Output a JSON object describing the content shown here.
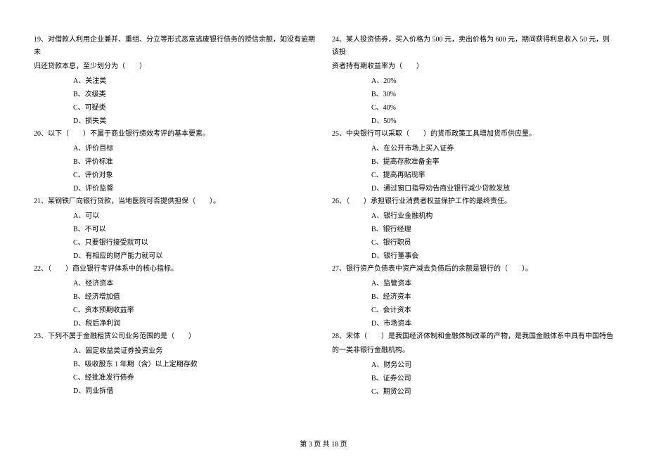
{
  "left": {
    "q19": {
      "line1": "19、对借款人利用企业兼并、重组、分立等形式恶意逃废银行债务的授信余额，如没有逾期未",
      "line2": "归还贷款本息，至少划分为（　　）",
      "opts": [
        "A、关注类",
        "B、次级类",
        "C、可疑类",
        "D、损失类"
      ]
    },
    "q20": {
      "line1": "20、以下（　　）不属于商业银行绩效考评的基本要素。",
      "opts": [
        "A、评价目标",
        "B、评价标准",
        "C、评价对象",
        "D、评价监督"
      ]
    },
    "q21": {
      "line1": "21、某钢铁厂向银行贷款，当地医院可否提供担保（　　）。",
      "opts": [
        "A、可以",
        "B、不可以",
        "C、只要银行接受就可以",
        "D、有相应的财产能力就可以"
      ]
    },
    "q22": {
      "line1": "22、（　　）商业银行考评体系中的核心指标。",
      "opts": [
        "A、经济资本",
        "B、经济增加值",
        "C、资本预期收益率",
        "D、税后净利润"
      ]
    },
    "q23": {
      "line1": "23、下列不属于金融租赁公司业务范围的是（　　）",
      "opts": [
        "A、固定收益类证券投资业务",
        "B、吸收股东 1 年期（含）以上定期存款",
        "C、经批准发行债券",
        "D、同业拆借"
      ]
    }
  },
  "right": {
    "q24": {
      "line1": "24、某人投资债券，买入价格为 500 元，卖出价格为 600 元，期间获得利息收入 50 元，则该投",
      "line2": "资者持有期收益率为（　　）",
      "opts": [
        "A、20%",
        "B、30%",
        "C、40%",
        "D、50%"
      ]
    },
    "q25": {
      "line1": "25、中央银行可以采取（　　）的货币政策工具增加货币供应量。",
      "opts": [
        "A、在公开市场上买入证券",
        "B、提高存款准备金率",
        "C、提高再贴现率",
        "D、通过窗口指导劝告商业银行减少贷款发放"
      ]
    },
    "q26": {
      "line1": "26、（　　）承担银行业消费者权益保护工作的最终责任。",
      "opts": [
        "A、银行业金融机构",
        "B、银行经理",
        "C、银行职员",
        "D、银行董事会"
      ]
    },
    "q27": {
      "line1": "27、银行资产负债表中资产减去负债后的余额是银行的（　　）。",
      "opts": [
        "A、监管资本",
        "B、经济资本",
        "C、会计资本",
        "D、市场资本"
      ]
    },
    "q28": {
      "line1": "28、宋体（　　）是我国经济体制和金融体制改革的产物，是我国金融体系中具有中国特色",
      "line2": "的一类非银行金融机构。",
      "opts": [
        "A、财务公司",
        "B、证券公司",
        "C、期货公司"
      ]
    }
  },
  "footer": "第 3 页 共 18 页"
}
